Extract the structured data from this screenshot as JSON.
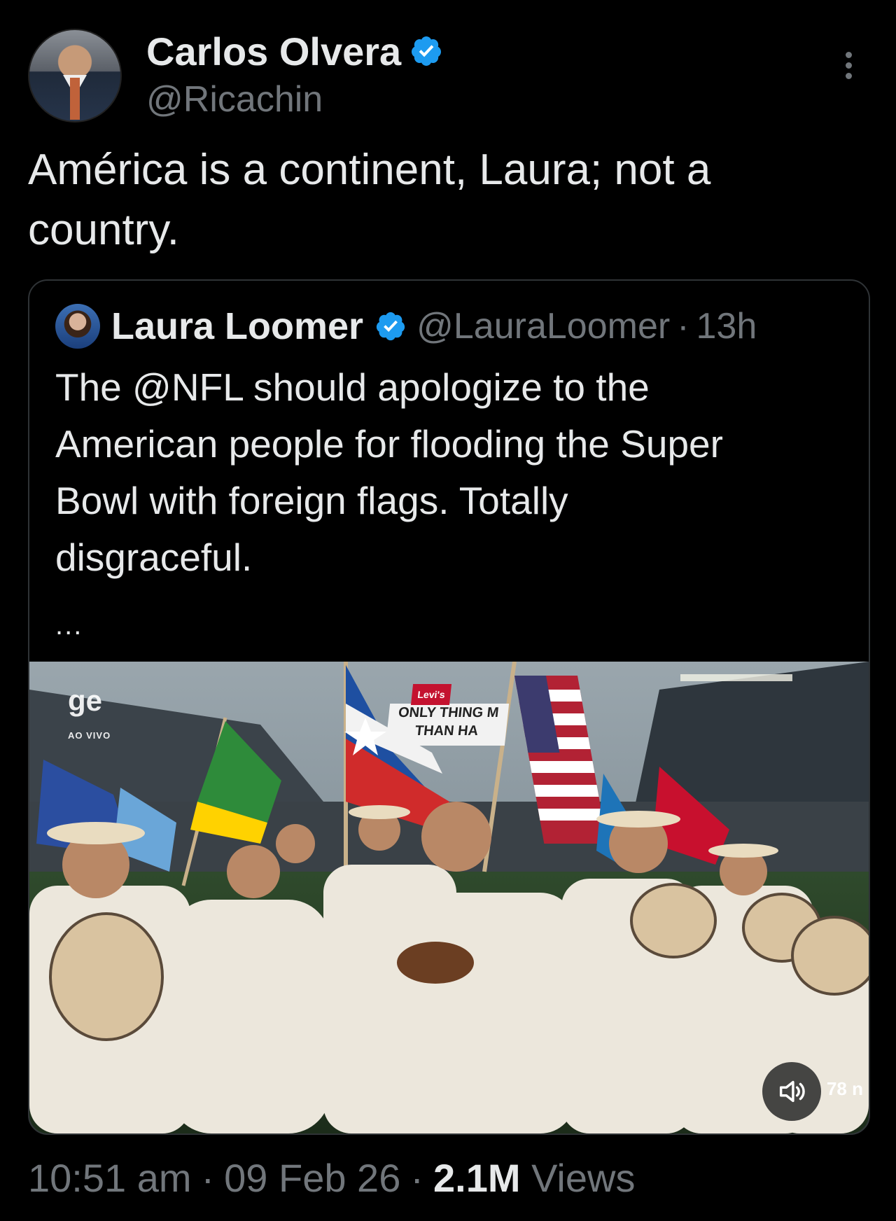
{
  "author": {
    "display_name": "Carlos Olvera",
    "handle": "@Ricachin",
    "verified": true
  },
  "tweet": {
    "text_line1": "América is a continent, Laura; not a",
    "text_line2": "country."
  },
  "quoted": {
    "display_name": "Laura Loomer",
    "handle": "@LauraLoomer",
    "separator": "·",
    "time": "13h",
    "text_line1": "The @NFL should apologize to the",
    "text_line2": "American people for flooding the Super",
    "text_line3": "Bowl with foreign flags. Totally",
    "text_line4": "disgraceful.",
    "ellipsis": "...",
    "media": {
      "logo_text": "ge",
      "logo_sub": "AO VIVO",
      "sign_brand": "Levi's",
      "sign_text_line1": "ONLY THING M",
      "sign_text_line2": "THAN HA",
      "overlay_count": "78 n"
    }
  },
  "meta": {
    "time": "10:51 am",
    "sep": "·",
    "date": "09 Feb 26",
    "views_count": "2.1M",
    "views_label": "Views"
  },
  "colors": {
    "background": "#000000",
    "text": "#e7e9ea",
    "secondary": "#71767b",
    "verified": "#1d9bf0",
    "border": "#2f3336"
  },
  "icons": {
    "verified": "verified-badge-icon",
    "more": "more-options-icon",
    "volume": "speaker-icon"
  }
}
